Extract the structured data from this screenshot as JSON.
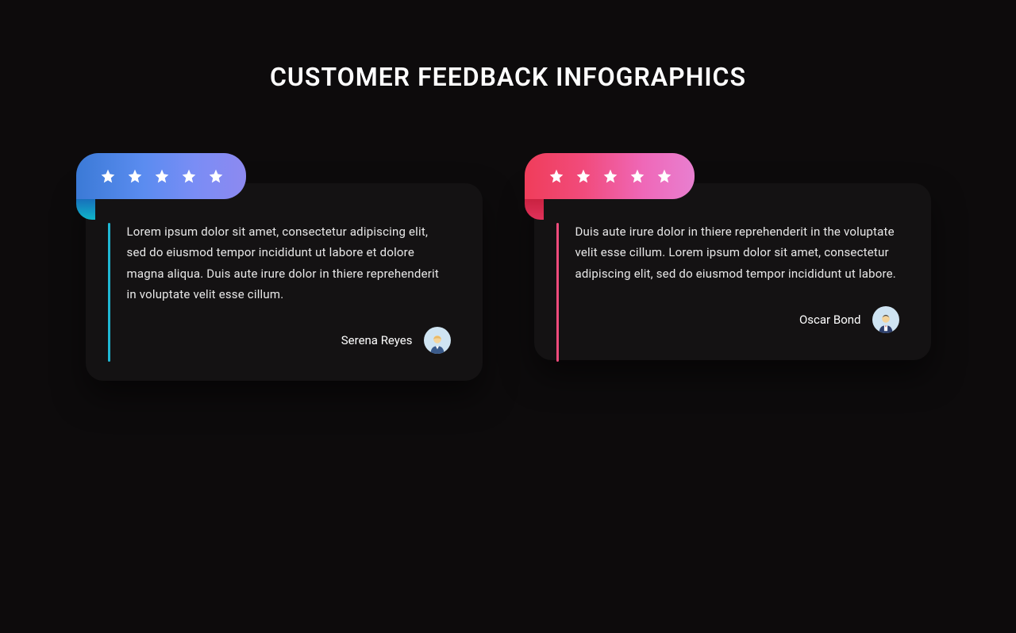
{
  "title": "CUSTOMER FEEDBACK INFOGRAPHICS",
  "cards": [
    {
      "rating": 5,
      "color": "blue",
      "text": "Lorem ipsum dolor sit amet, consectetur adipiscing elit, sed do eiusmod tempor incididunt ut labore et dolore magna aliqua. Duis aute irure dolor in thiere reprehenderit in voluptate velit esse cillum.",
      "author": "Serena Reyes"
    },
    {
      "rating": 5,
      "color": "pink",
      "text": "Duis aute irure dolor in thiere reprehenderit in the voluptate velit esse cillum. Lorem ipsum dolor sit amet, consectetur adipiscing elit, sed do eiusmod tempor incididunt ut labore.",
      "author": "Oscar Bond"
    }
  ]
}
